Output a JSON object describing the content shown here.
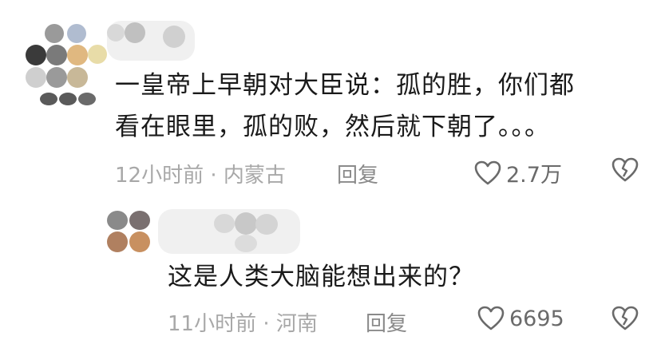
{
  "comments": [
    {
      "text_line1": "一皇帝上早朝对大臣说：孤的胜，你们都",
      "text_line2": "看在眼里，孤的败，然后就下朝了。。。",
      "meta": "12小时前 · 内蒙古",
      "reply_label": "回复",
      "likes": "2.7万"
    },
    {
      "text_line1": "这是人类大脑能想出来的？",
      "meta": "11小时前 · 河南",
      "reply_label": "回复",
      "likes": "6695"
    }
  ],
  "icons": {
    "like": "heart-outline-icon",
    "dislike": "broken-heart-icon"
  },
  "colors": {
    "text": "#1a1a1a",
    "meta": "#a8a8a8",
    "icon": "#6a6a6a"
  }
}
